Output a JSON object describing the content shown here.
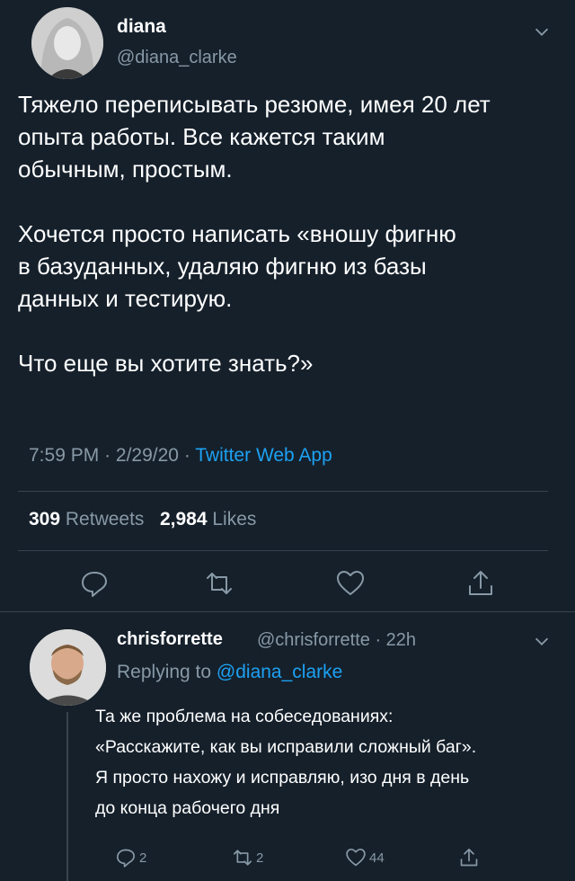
{
  "tweet": {
    "author_name": "diana",
    "author_handle": "@diana_clarke",
    "text": "Тяжело переписывать резюме, имея 20 лет\nопыта работы. Все кажется таким\nобычным, простым.\n\nХочется просто написать «вношу фигню\nв базуданных, удаляю фигню из базы\nданных и тестирую.\n\nЧто еще вы хотите знать?»",
    "time": "7:59 PM",
    "date": "2/29/20",
    "source": "Twitter Web App",
    "retweets": "309",
    "retweets_label": "Retweets",
    "likes": "2,984",
    "likes_label": "Likes"
  },
  "reply": {
    "author_name": "chrisforrette",
    "author_handle": "@chrisforrette",
    "age": "22h",
    "replying_to_prefix": "Replying to",
    "replying_to_handle": "@diana_clarke",
    "text": "Та же проблема на собеседованиях:\n«Расскажите, как вы исправили сложный баг».\nЯ просто нахожу и исправляю, изо дня в день\nдо конца рабочего дня",
    "reply_count": "2",
    "retweet_count": "2",
    "like_count": "44"
  },
  "icons": {
    "more": "chevron-down-icon",
    "reply": "reply-icon",
    "retweet": "retweet-icon",
    "like": "heart-icon",
    "share": "share-icon"
  },
  "colors": {
    "background": "#15202b",
    "secondary_text": "#8899a6",
    "accent": "#1da1f2",
    "divider": "#38444d"
  }
}
